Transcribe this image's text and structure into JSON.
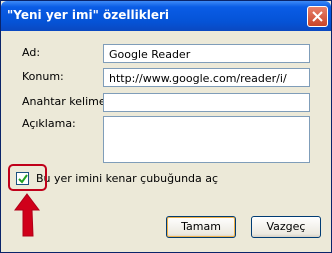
{
  "dialog": {
    "title": "\"Yeni yer imi\" özellikleri"
  },
  "form": {
    "name_label": "Ad:",
    "name_value": "Google Reader",
    "location_label": "Konum:",
    "location_value": "http://www.google.com/reader/i/",
    "keyword_label": "Anahtar kelime:",
    "keyword_value": "",
    "description_label": "Açıklama:",
    "description_value": "",
    "sidebar_checkbox_label": "Bu yer imini kenar çubuğunda aç",
    "sidebar_checkbox_checked": true
  },
  "buttons": {
    "ok_label": "Tamam",
    "cancel_label": "Vazgeç"
  },
  "colors": {
    "titlebar": "#0553d6",
    "annotation": "#c0001a"
  },
  "icons": {
    "close": "close-icon",
    "checkmark": "checkmark-icon",
    "annotation_arrow": "arrow-up-icon"
  }
}
